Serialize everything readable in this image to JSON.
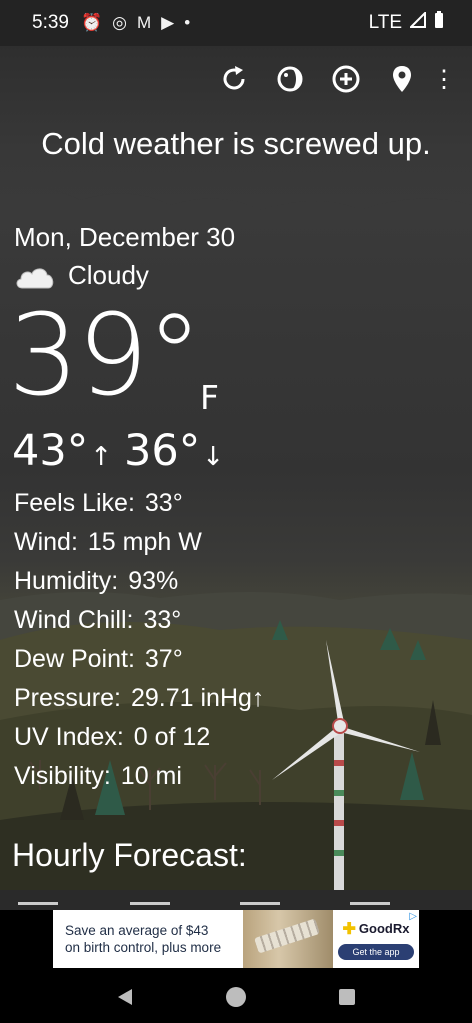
{
  "status": {
    "time": "5:39",
    "icons": [
      "alarm-icon",
      "instagram-icon",
      "gmail-icon",
      "youtube-icon",
      "dot-icon"
    ],
    "network": "LTE"
  },
  "toolbar": {
    "actions": [
      "refresh-icon",
      "theme-icon",
      "add-location-icon",
      "location-pin-icon",
      "more-options-icon"
    ]
  },
  "tagline": "Cold weather is screwed up.",
  "weather": {
    "date": "Mon, December 30",
    "condition": "Cloudy",
    "temp": "39°",
    "unit": "F",
    "high": "43°",
    "low": "36°"
  },
  "details": [
    {
      "label": "Feels Like:",
      "value": "33°"
    },
    {
      "label": "Wind:",
      "value": "15 mph W"
    },
    {
      "label": "Humidity:",
      "value": "93%"
    },
    {
      "label": "Wind Chill:",
      "value": "33°"
    },
    {
      "label": "Dew Point:",
      "value": "37°"
    },
    {
      "label": "Pressure:",
      "value": "29.71 inHg↑"
    },
    {
      "label": "UV Index:",
      "value": "0 of 12"
    },
    {
      "label": "Visibility:",
      "value": "10 mi"
    }
  ],
  "hourly": {
    "title": "Hourly Forecast:"
  },
  "ad": {
    "line1": "Save an average of $43",
    "line2": "on birth control, plus more",
    "brand": "GoodRx",
    "cta": "Get the app"
  },
  "colors": {
    "sky": "#2a2a2a",
    "hill": "#4c4c36",
    "ad_text": "#1f2d45",
    "cta": "#2b3f73"
  }
}
